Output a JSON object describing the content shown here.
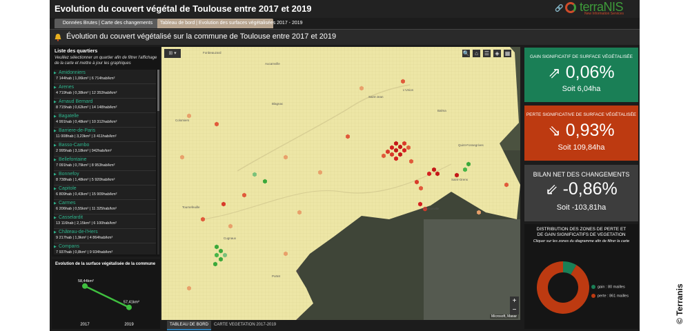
{
  "header": {
    "title": "Evolution du couvert végétal de Toulouse entre 2017 et 2019",
    "logo_text": "terraNIS",
    "logo_tagline": "New Information Services"
  },
  "tabs": [
    {
      "label": "Données Brutes | Carte des changements",
      "active": false
    },
    {
      "label": "Tableau de bord | Evolution des surfaces végétalisées 2017 - 2019",
      "active": true
    }
  ],
  "subheader": {
    "title": "Évolution du couvert végétalisé sur la commune de Toulouse entre 2017 et 2019"
  },
  "quartiers": {
    "title": "Liste des quartiers",
    "hint": "Veuillez sélectionner un quartier afin de filtrer l'affichage de la carte et mettre à jour les graphiques",
    "items": [
      {
        "name": "Amidonniers",
        "stats": "7 144hab | 1,06km² | 6 714hab/km²"
      },
      {
        "name": "Arenes",
        "stats": "4 719hab | 0,38km² | 12 353hab/km²"
      },
      {
        "name": "Arnaud Bernard",
        "stats": "8 715hab | 0,62km² | 14 148hab/km²"
      },
      {
        "name": "Bagatelle",
        "stats": "4 991hab | 0,48km² | 10 312hab/km²"
      },
      {
        "name": "Barriere-de-Paris",
        "stats": "11 008hab | 3,23km² | 3 411hab/km²"
      },
      {
        "name": "Basso-Cambo",
        "stats": "2 995hab | 3,18km² | 942hab/km²"
      },
      {
        "name": "Bellefontaine",
        "stats": "7 091hab | 0,79km² | 8 953hab/km²"
      },
      {
        "name": "Bonnefoy",
        "stats": "8 738hab | 1,48km² | 5 920hab/km²"
      },
      {
        "name": "Capitole",
        "stats": "6 809hab | 0,43km² | 15 909hab/km²"
      },
      {
        "name": "Carmes",
        "stats": "6 206hab | 0,55km² | 11 325hab/km²"
      },
      {
        "name": "Casselardit",
        "stats": "13 116hab | 2,15km² | 6 100hab/km²"
      },
      {
        "name": "Château-de-l'Hers",
        "stats": "9 217hab | 1,9km² | 4 864hab/km²"
      },
      {
        "name": "Compans",
        "stats": "7 937hab | 0,8km² | 9 934hab/km²"
      }
    ]
  },
  "evolution": {
    "title": "Evolution de la surface végétalisée de la commune",
    "chart_data": {
      "type": "line",
      "categories": [
        "2017",
        "2019"
      ],
      "series": [
        {
          "values": [
            58.44,
            57.41
          ]
        }
      ],
      "data_labels": [
        "58,44km²",
        "57,41km²"
      ],
      "color": "#3fbf3f"
    }
  },
  "map": {
    "labels": [
      "Fonbeauzard",
      "Aucamville",
      "L'Union",
      "Saint-Jean",
      "Balma",
      "Quint-Fonsegrives",
      "Saint-Orens",
      "Ramonville",
      "Colomiers",
      "Tournefeuille",
      "Cugnaux",
      "Blagnac",
      "Portet"
    ],
    "attribution": "Microsoft, Maxar",
    "zoom_in": "+",
    "zoom_out": "−"
  },
  "bottom_tabs": [
    {
      "label": "TABLEAU DE BORD",
      "active": true
    },
    {
      "label": "CARTE VEGETATION 2017-2019",
      "active": false
    }
  ],
  "kpis": {
    "gain": {
      "label": "GAIN SIGNIFICATIF DE SURFACE VÉGÉTALISÉE",
      "value": "0,06%",
      "sub": "Soit 6,04ha",
      "color": "#1a7f56"
    },
    "loss": {
      "label": "PERTE SIGNIFICATIVE DE SURFACE VÉGÉTALISÉE",
      "value": "0,93%",
      "sub": "Soit 109,84ha",
      "color": "#bd3a11"
    },
    "net": {
      "label": "BILAN NET DES CHANGEMENTS",
      "value": "-0,86%",
      "sub": "Soit -103,81ha",
      "color": "#3d3d3d"
    }
  },
  "distribution": {
    "title_line1": "DISTRIBUTION DES ZONES DE PERTE ET",
    "title_line2": "DE GAIN SIGNIFICATIFS DE VEGETATION",
    "hint": "Cliquer sur les zones du diagramme afin de filtrer la carte",
    "chart_data": {
      "type": "pie",
      "categories": [
        "gain",
        "perte"
      ],
      "values": [
        80,
        861
      ],
      "legend_labels": [
        "gain : 80 mailles",
        "perte : 861 mailles"
      ],
      "colors": [
        "#1a7f56",
        "#bd3a11"
      ],
      "legend": "right"
    }
  },
  "copyright": "© Terranis"
}
